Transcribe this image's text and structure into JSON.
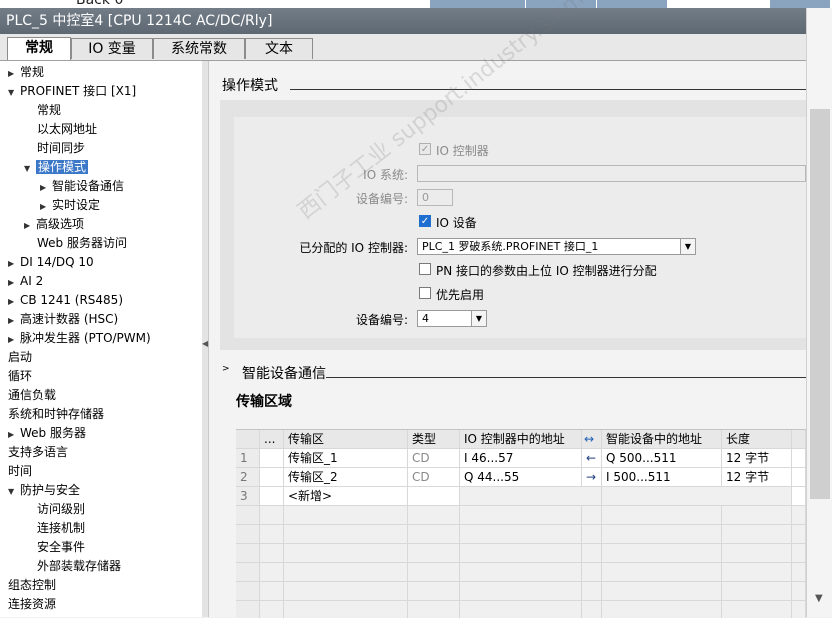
{
  "top_strip_label": "Back 0",
  "window_title": "PLC_5 中控室4 [CPU 1214C AC/DC/Rly]",
  "tabs": [
    "常规",
    "IO 变量",
    "系统常数",
    "文本"
  ],
  "tree": [
    {
      "label": "常规",
      "arrow": "right"
    },
    {
      "label": "PROFINET 接口 [X1]",
      "arrow": "down"
    },
    {
      "label": "常规",
      "arrow": ""
    },
    {
      "label": "以太网地址",
      "arrow": ""
    },
    {
      "label": "时间同步",
      "arrow": ""
    },
    {
      "label": "操作模式",
      "arrow": "down",
      "selected": true
    },
    {
      "label": "智能设备通信",
      "arrow": "right"
    },
    {
      "label": "实时设定",
      "arrow": "right"
    },
    {
      "label": "高级选项",
      "arrow": "right"
    },
    {
      "label": "Web 服务器访问",
      "arrow": ""
    },
    {
      "label": "DI 14/DQ 10",
      "arrow": "right"
    },
    {
      "label": "AI 2",
      "arrow": "right"
    },
    {
      "label": "CB 1241 (RS485)",
      "arrow": "right"
    },
    {
      "label": "高速计数器 (HSC)",
      "arrow": "right"
    },
    {
      "label": "脉冲发生器 (PTO/PWM)",
      "arrow": "right"
    },
    {
      "label": "启动",
      "arrow": ""
    },
    {
      "label": "循环",
      "arrow": ""
    },
    {
      "label": "通信负载",
      "arrow": ""
    },
    {
      "label": "系统和时钟存储器",
      "arrow": ""
    },
    {
      "label": "Web 服务器",
      "arrow": "right"
    },
    {
      "label": "支持多语言",
      "arrow": ""
    },
    {
      "label": "时间",
      "arrow": ""
    },
    {
      "label": "防护与安全",
      "arrow": "down"
    },
    {
      "label": "访问级别",
      "arrow": ""
    },
    {
      "label": "连接机制",
      "arrow": ""
    },
    {
      "label": "安全事件",
      "arrow": ""
    },
    {
      "label": "外部装载存储器",
      "arrow": ""
    },
    {
      "label": "组态控制",
      "arrow": ""
    },
    {
      "label": "连接资源",
      "arrow": ""
    }
  ],
  "section_title": "操作模式",
  "op_mode": {
    "io_controller_label": "IO 控制器",
    "io_system_label": "IO 系统:",
    "device_number_label": "设备编号:",
    "device_number_value": "0",
    "io_device_label": "IO 设备",
    "assigned_controller_label": "已分配的 IO 控制器:",
    "assigned_controller_value": "PLC_1 罗破系统.PROFINET 接口_1",
    "pn_param_label": "PN 接口的参数由上位 IO 控制器进行分配",
    "priority_label": "优先启用",
    "device_number2_label": "设备编号:",
    "device_number2_value": "4"
  },
  "section2_title": "智能设备通信",
  "table_title": "传输区域",
  "grid": {
    "headers": [
      "...",
      "传输区",
      "类型",
      "IO 控制器中的地址",
      "↔",
      "智能设备中的地址",
      "长度"
    ],
    "rows": [
      {
        "n": "1",
        "name": "传输区_1",
        "type": "CD",
        "ctrl": "I 46...57",
        "dir": "←",
        "dev": "Q 500...511",
        "len": "12 字节"
      },
      {
        "n": "2",
        "name": "传输区_2",
        "type": "CD",
        "ctrl": "Q 44...55",
        "dir": "→",
        "dev": "I 500...511",
        "len": "12 字节"
      },
      {
        "n": "3",
        "name": "<新增>",
        "type": "",
        "ctrl": "",
        "dir": "",
        "dev": "",
        "len": ""
      }
    ]
  },
  "watermark": "西门子工业 support.industry.siemens.com/cs"
}
